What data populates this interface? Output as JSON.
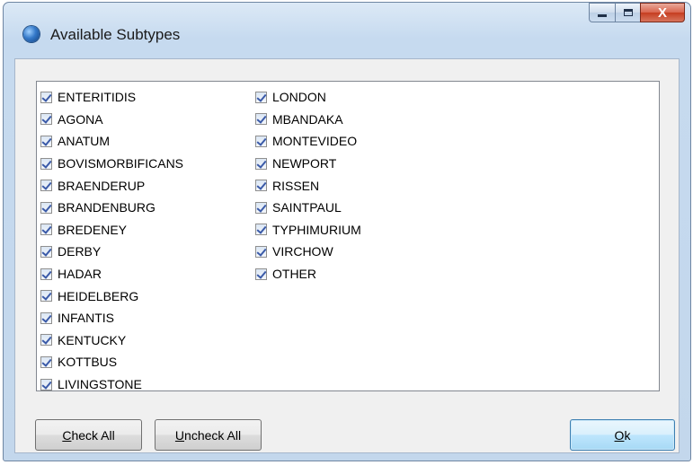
{
  "window": {
    "title": "Available Subtypes",
    "caption": {
      "minimize": "—",
      "maximize": "□",
      "close": "X"
    }
  },
  "list": {
    "column1": [
      {
        "label": "ENTERITIDIS",
        "checked": true
      },
      {
        "label": "AGONA",
        "checked": true
      },
      {
        "label": "ANATUM",
        "checked": true
      },
      {
        "label": "BOVISMORBIFICANS",
        "checked": true
      },
      {
        "label": "BRAENDERUP",
        "checked": true
      },
      {
        "label": "BRANDENBURG",
        "checked": true
      },
      {
        "label": "BREDENEY",
        "checked": true
      },
      {
        "label": "DERBY",
        "checked": true
      },
      {
        "label": "HADAR",
        "checked": true
      },
      {
        "label": "HEIDELBERG",
        "checked": true
      },
      {
        "label": "INFANTIS",
        "checked": true
      },
      {
        "label": "KENTUCKY",
        "checked": true
      },
      {
        "label": "KOTTBUS",
        "checked": true
      },
      {
        "label": "LIVINGSTONE",
        "checked": true
      }
    ],
    "column2": [
      {
        "label": "LONDON",
        "checked": true
      },
      {
        "label": "MBANDAKA",
        "checked": true
      },
      {
        "label": "MONTEVIDEO",
        "checked": true
      },
      {
        "label": "NEWPORT",
        "checked": true
      },
      {
        "label": "RISSEN",
        "checked": true
      },
      {
        "label": "SAINTPAUL",
        "checked": true
      },
      {
        "label": "TYPHIMURIUM",
        "checked": true
      },
      {
        "label": "VIRCHOW",
        "checked": true
      },
      {
        "label": "OTHER",
        "checked": true
      }
    ]
  },
  "buttons": {
    "check_all": {
      "mnemonic": "C",
      "rest": "heck All"
    },
    "uncheck_all": {
      "mnemonic": "U",
      "rest": "ncheck All"
    },
    "ok": {
      "mnemonic": "O",
      "rest": "k"
    }
  },
  "colors": {
    "window_frame": "#c3d7ec",
    "close_button": "#c53d20",
    "checkmark": "#3a5aa8",
    "ok_border": "#3c7fb1"
  }
}
